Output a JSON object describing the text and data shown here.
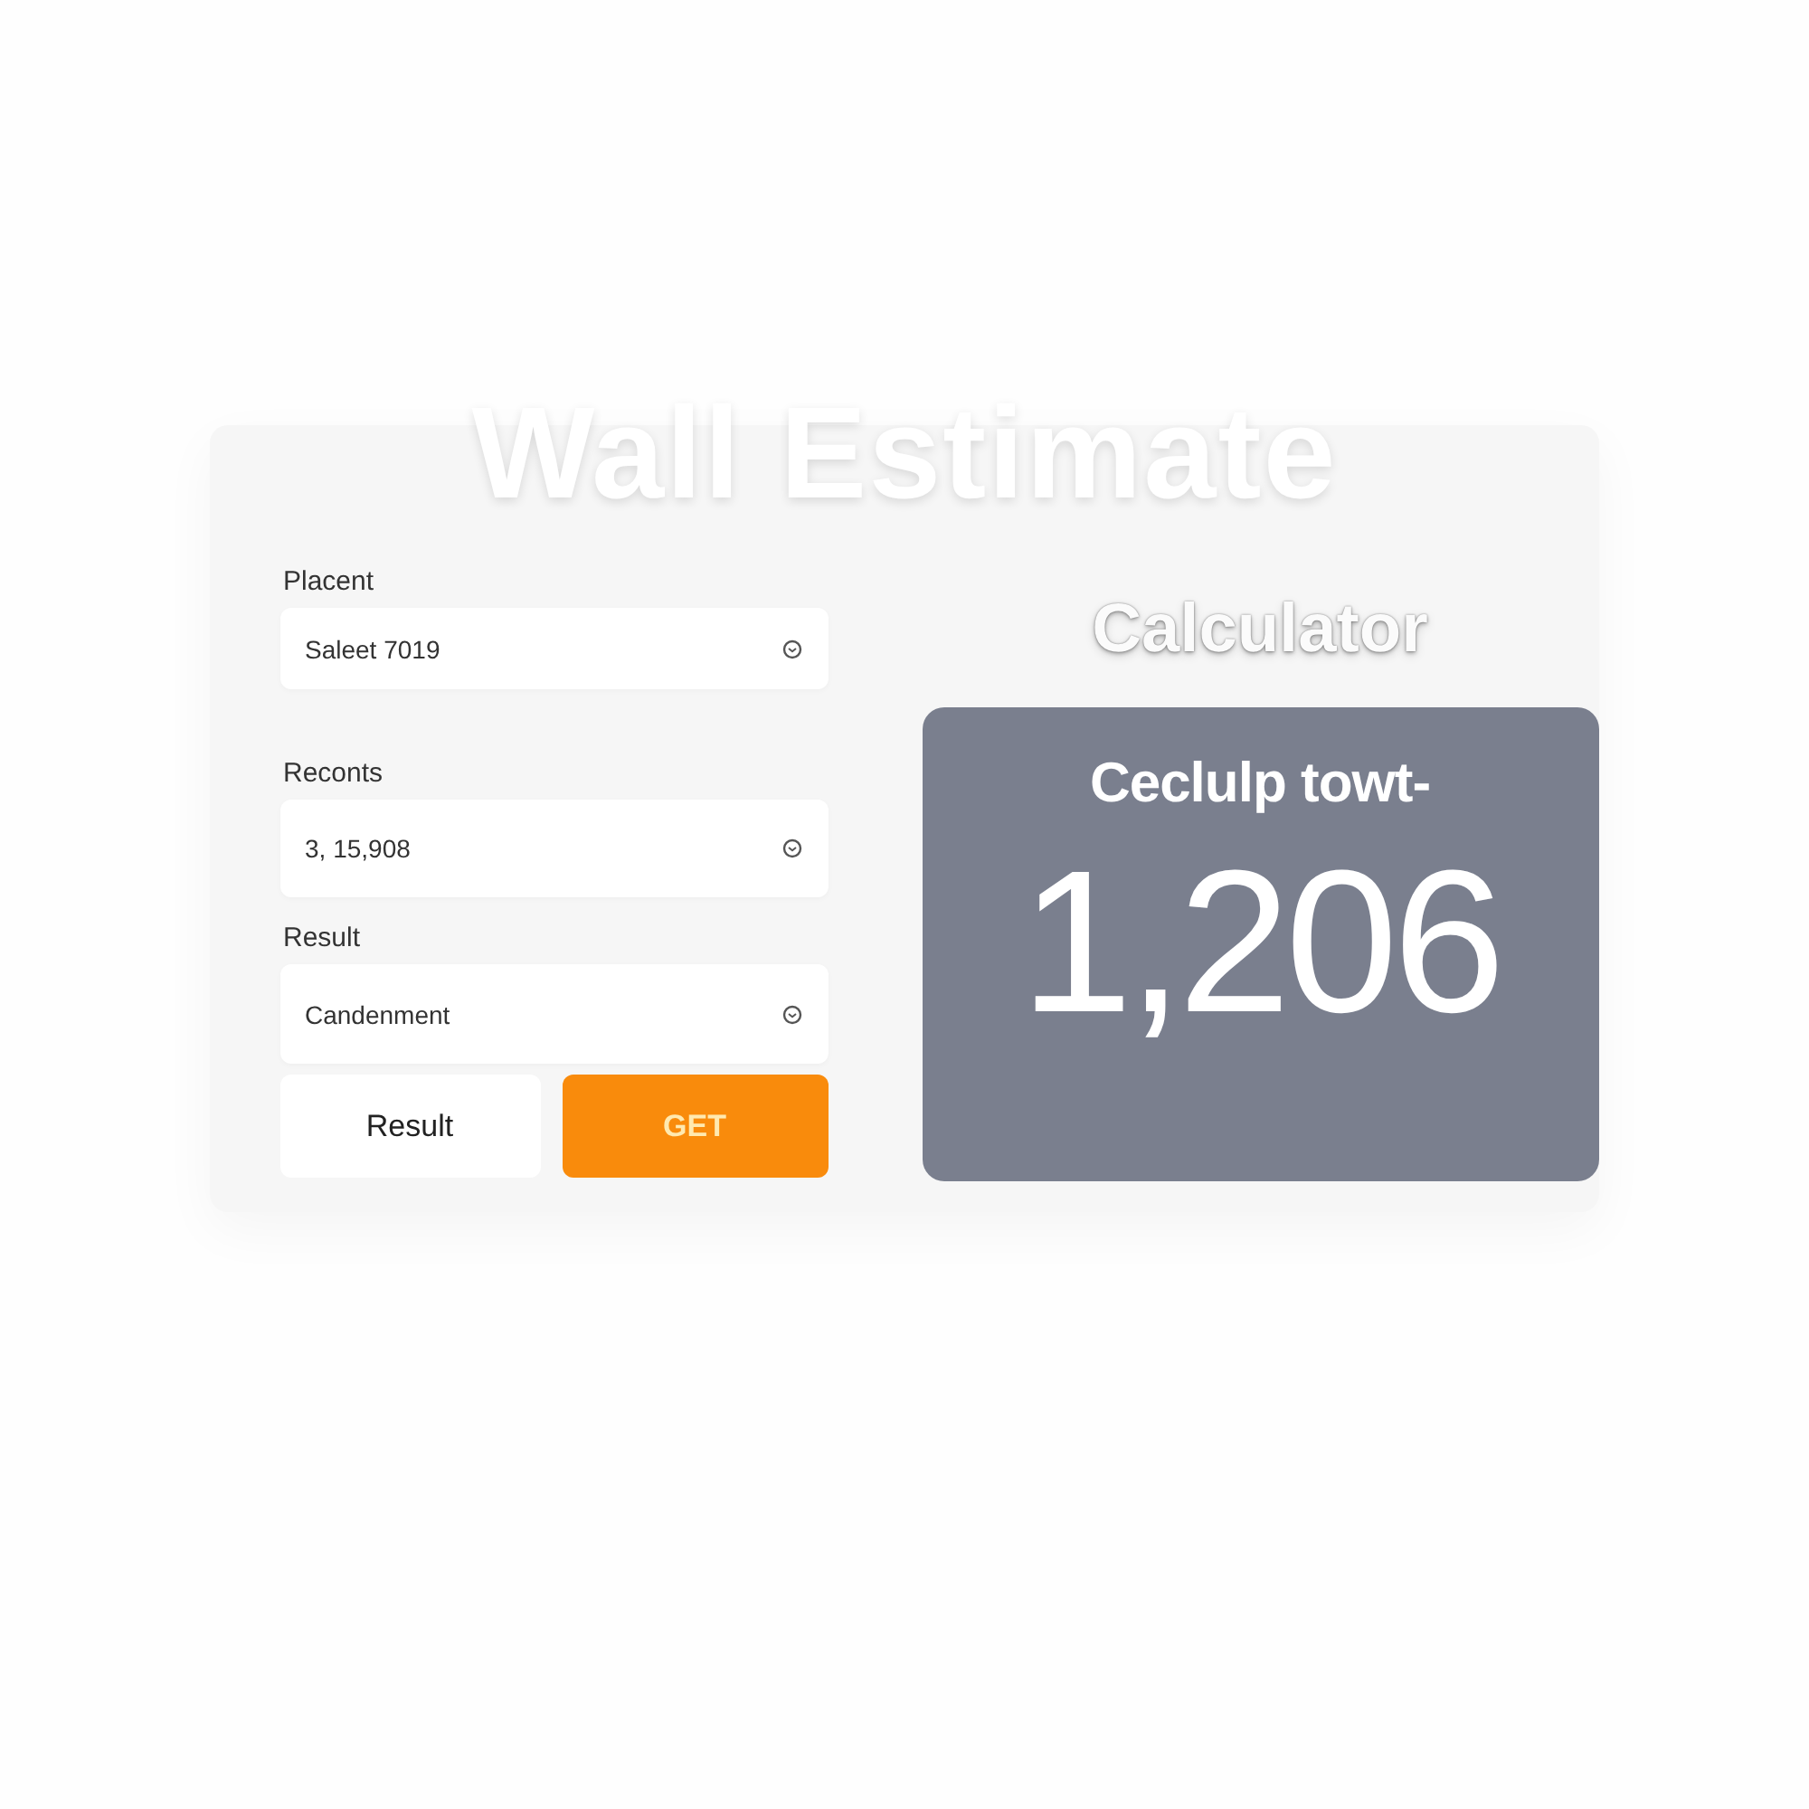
{
  "title": "Wall Estimate",
  "subtitle": "Calculator",
  "fields": [
    {
      "label": "Placent",
      "value": "Saleet 7019"
    },
    {
      "label": "Reconts",
      "value": "3, 15,908"
    },
    {
      "label": "Result",
      "value": "Candenment"
    }
  ],
  "buttons": [
    {
      "label": "Result",
      "kind": "secondary"
    },
    {
      "label": "GET",
      "kind": "primary"
    }
  ],
  "result": {
    "label": "Ceclulp towt-",
    "value": "1,206"
  }
}
